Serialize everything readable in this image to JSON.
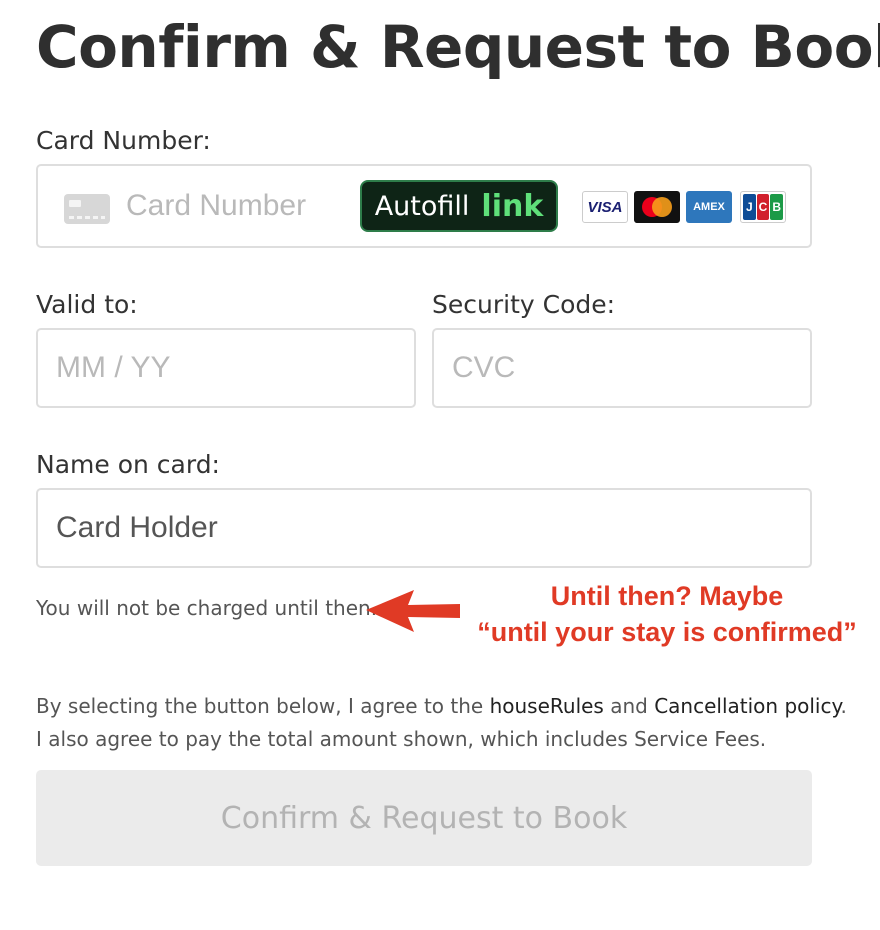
{
  "title": "Confirm & Request to Book",
  "card_number": {
    "label": "Card Number:",
    "placeholder": "Card Number",
    "autofill_text": "Autofill",
    "autofill_link": "link",
    "brands": {
      "visa": "VISA",
      "amex": "AMEX",
      "jcb": [
        "J",
        "C",
        "B"
      ]
    }
  },
  "valid_to": {
    "label": "Valid to:",
    "placeholder": "MM / YY"
  },
  "security_code": {
    "label": "Security Code:",
    "placeholder": "CVC"
  },
  "name_on_card": {
    "label": "Name on card:",
    "value": "Card Holder"
  },
  "charge_note": "You will not be charged until then.",
  "annotation": {
    "line1": "Until then?  Maybe",
    "line2": "“until your stay is confirmed”",
    "color": "#e03a25"
  },
  "agreement": {
    "prefix": "By selecting the button below, I agree to the ",
    "house_rules": "houseRules",
    "and": " and ",
    "cancellation": "Cancellation policy",
    "suffix": ".",
    "line2": "I also agree to pay the total amount shown, which includes Service Fees."
  },
  "submit_label": "Confirm & Request to Book"
}
